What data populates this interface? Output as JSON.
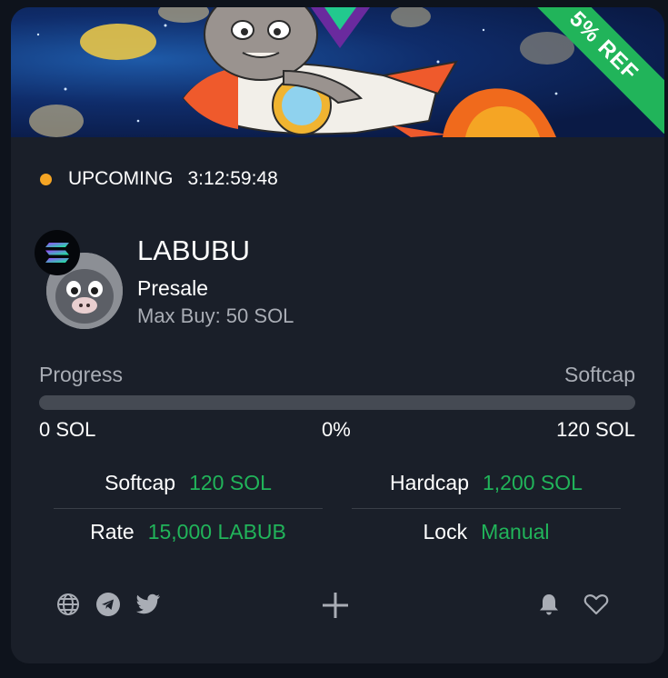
{
  "banner": {
    "ribbon_label": "5% REF",
    "ribbon_color": "#21b45a"
  },
  "status": {
    "label": "UPCOMING",
    "countdown": "3:12:59:48",
    "dot_color": "#f5a524"
  },
  "token": {
    "name": "LABUBU",
    "type": "Presale",
    "max_buy": "Max Buy: 50 SOL",
    "chain_icon": "solana-icon"
  },
  "progress": {
    "label": "Progress",
    "target_label": "Softcap",
    "start_value": "0 SOL",
    "percent_text": "0%",
    "percent": 0,
    "end_value": "120 SOL"
  },
  "stats": {
    "softcap": {
      "label": "Softcap",
      "value": "120 SOL"
    },
    "hardcap": {
      "label": "Hardcap",
      "value": "1,200 SOL"
    },
    "rate": {
      "label": "Rate",
      "value": "15,000 LABUB"
    },
    "lock": {
      "label": "Lock",
      "value": "Manual"
    }
  },
  "icons": {
    "left": [
      "globe-icon",
      "telegram-icon",
      "twitter-icon"
    ],
    "center": "plus-icon",
    "right": [
      "bell-icon",
      "heart-icon"
    ]
  },
  "colors": {
    "accent_green": "#21b45a",
    "card_bg": "#1a1f29",
    "page_bg": "#0e131c",
    "muted_text": "#a9adb5"
  }
}
